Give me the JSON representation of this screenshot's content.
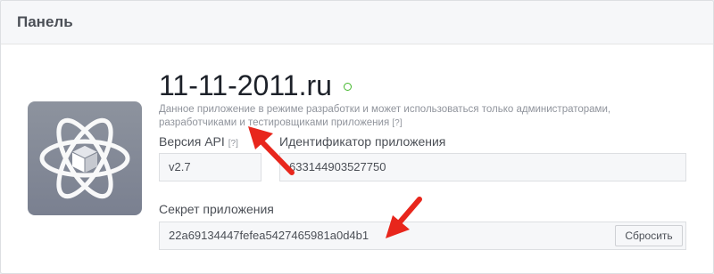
{
  "panel": {
    "title": "Панель"
  },
  "app": {
    "name": "11-11-2011.ru",
    "status_color": "#42b72a",
    "icon": "atom-cube-icon",
    "description_line1": "Данное приложение в режиме разработки и может использоваться только администраторами,",
    "description_line2": "разработчиками и тестировщиками приложения",
    "description_hint": "[?]"
  },
  "api_version": {
    "label": "Версия API",
    "hint": "[?]",
    "value": "v2.7"
  },
  "app_id": {
    "label": "Идентификатор приложения",
    "value": "633144903527750"
  },
  "app_secret": {
    "label": "Секрет приложения",
    "value": "22a69134447fefea5427465981a0d4b1",
    "reset_label": "Сбросить"
  },
  "annotations": {
    "arrow_color": "#e8261c"
  }
}
